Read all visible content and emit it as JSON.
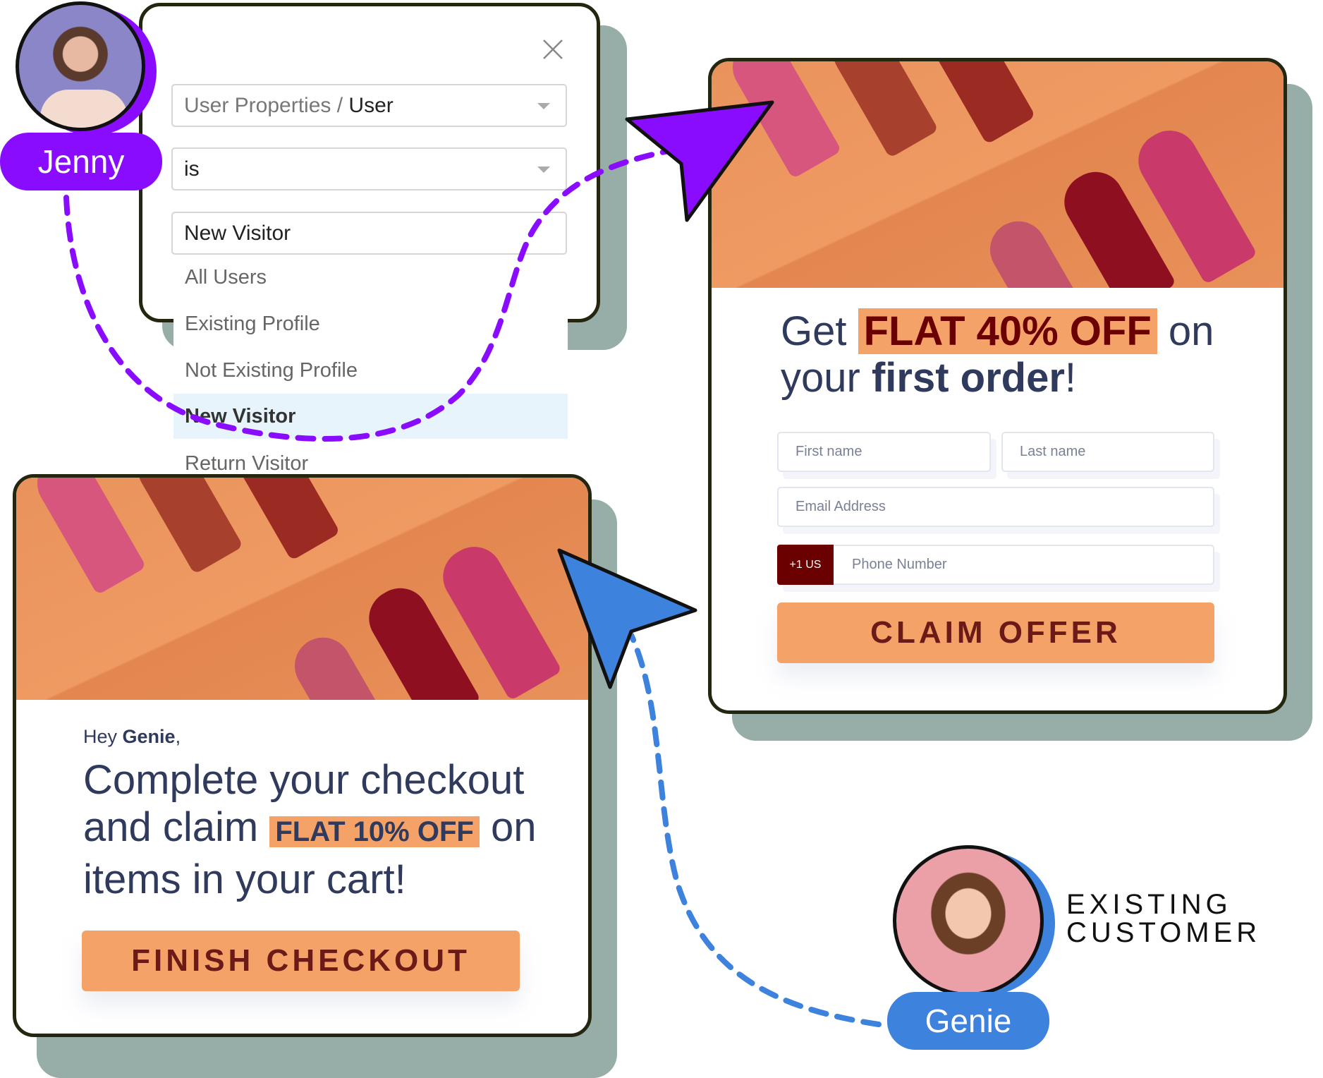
{
  "filter_panel": {
    "property_select": {
      "prefix": "User Properties / ",
      "value": "User"
    },
    "operator_select": {
      "value": "is"
    },
    "value_input": {
      "value": "New Visitor"
    },
    "dropdown_options": [
      "All Users",
      "Existing Profile",
      "Not Existing Profile",
      "New Visitor",
      "Return Visitor"
    ],
    "highlighted_option": "New Visitor"
  },
  "jenny": {
    "name": "Jenny",
    "color": "#8a0cff"
  },
  "genie": {
    "name": "Genie",
    "label_line1": "EXISTING",
    "label_line2": "CUSTOMER",
    "color": "#3d82dc"
  },
  "offer_popup": {
    "headline_get": "Get",
    "headline_highlight": "FLAT 40% OFF",
    "headline_on": "on",
    "headline_your": "your",
    "headline_bold": "first order",
    "headline_end": "!",
    "first_name_placeholder": "First name",
    "last_name_placeholder": "Last name",
    "email_placeholder": "Email Address",
    "phone_code": "+1 US",
    "phone_placeholder": "Phone Number",
    "cta": "CLAIM OFFER"
  },
  "checkout_popup": {
    "greeting": "Hey ",
    "greeting_name": "Genie",
    "greeting_end": ",",
    "line1": "Complete your checkout",
    "line2_start": "and claim ",
    "line2_highlight": "FLAT 10% OFF",
    "line2_end": " on",
    "line3": "items in your cart!",
    "cta": "FINISH CHECKOUT"
  },
  "colors": {
    "accent_orange": "#f4a268",
    "dark_red": "#6b0000",
    "navy": "#2f3a5c",
    "shadow": "#97ada7"
  }
}
